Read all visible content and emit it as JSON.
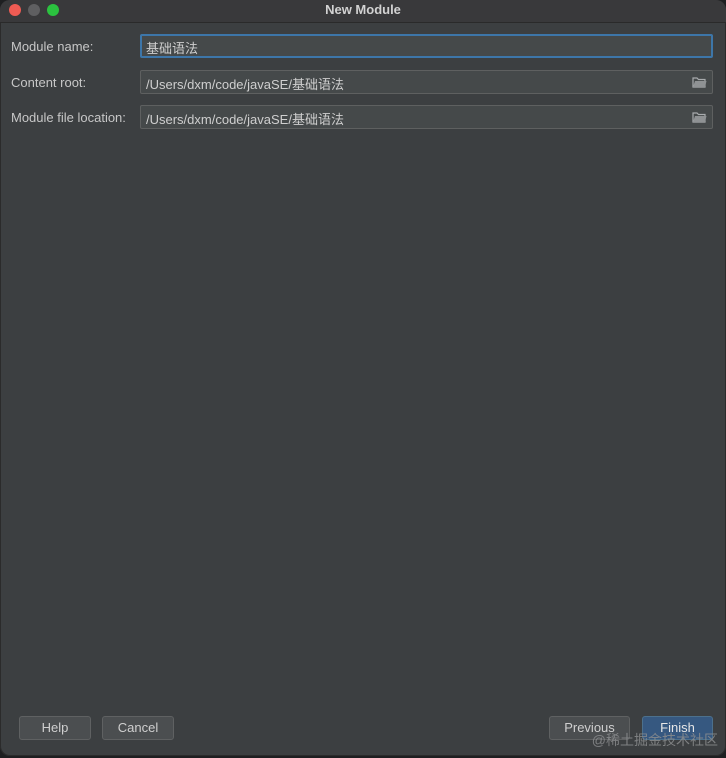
{
  "window": {
    "title": "New Module"
  },
  "form": {
    "module_name": {
      "label": "Module name:",
      "value": "基础语法"
    },
    "content_root": {
      "label": "Content root:",
      "value": "/Users/dxm/code/javaSE/基础语法"
    },
    "module_file_location": {
      "label": "Module file location:",
      "value": "/Users/dxm/code/javaSE/基础语法"
    }
  },
  "buttons": {
    "help": "Help",
    "cancel": "Cancel",
    "previous": "Previous",
    "finish": "Finish"
  },
  "watermark": "@稀土掘金技术社区",
  "colors": {
    "background": "#3c3f41",
    "field": "#45494a",
    "focus_border": "#3d76a9",
    "primary_button": "#365880"
  },
  "icons": {
    "browse": "folder-icon"
  }
}
